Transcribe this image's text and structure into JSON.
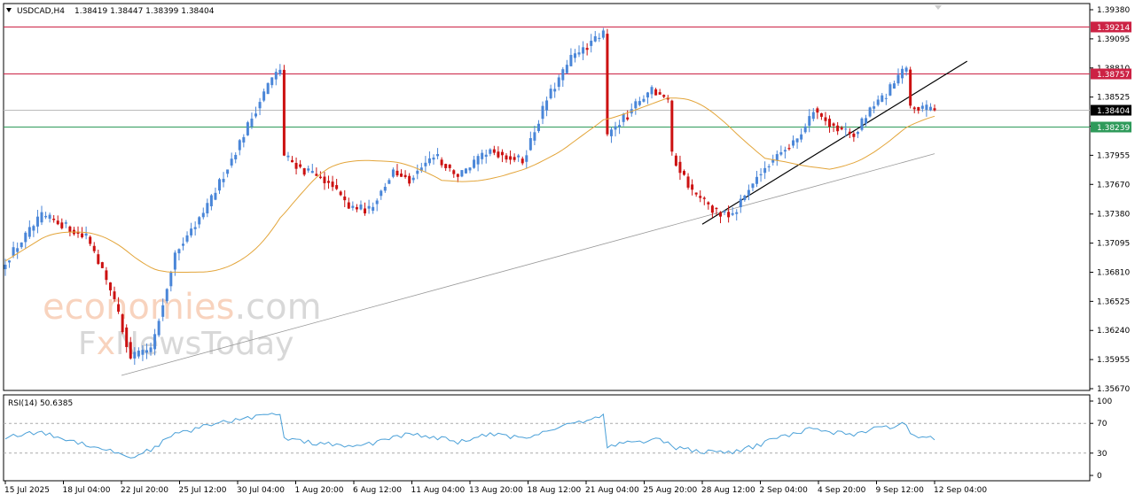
{
  "header": {
    "symbol": "USDCAD,H4",
    "ohlc": "1.38419 1.38447 1.38399 1.38404"
  },
  "watermark": {
    "line1a": "economies",
    "line1b": ".com",
    "line2a": "F",
    "line2b": "x",
    "line2c": "NewsToday"
  },
  "colors": {
    "bull": "#4a86d8",
    "bear": "#cc1111",
    "ma": "#e3a53a",
    "resistance": "#cc2244",
    "current": "#bbbbbb",
    "support": "#2e9a5a",
    "rsi": "#4aa0d8",
    "trend_main": "#000000",
    "trend_long": "#999999"
  },
  "chart_data": [
    {
      "type": "candlestick",
      "title": "",
      "x_tick_labels": [
        "15 Jul 2025",
        "18 Jul 04:00",
        "22 Jul 20:00",
        "25 Jul 12:00",
        "30 Jul 04:00",
        "1 Aug 20:00",
        "6 Aug 12:00",
        "11 Aug 04:00",
        "13 Aug 20:00",
        "18 Aug 12:00",
        "21 Aug 04:00",
        "25 Aug 20:00",
        "28 Aug 12:00",
        "2 Sep 04:00",
        "4 Sep 20:00",
        "9 Sep 12:00",
        "12 Sep 04:00"
      ],
      "y_tick_labels": [
        "1.39380",
        "1.39095",
        "1.38810",
        "1.38525",
        "1.38240",
        "1.37955",
        "1.37670",
        "1.37380",
        "1.37095",
        "1.36810",
        "1.36525",
        "1.36240",
        "1.35955",
        "1.35670"
      ],
      "ylim": [
        1.3567,
        1.3938
      ],
      "levels": [
        {
          "name": "resistance-upper",
          "value": 1.39214,
          "label": "1.39214"
        },
        {
          "name": "resistance-lower",
          "value": 1.38757,
          "label": "1.38757"
        },
        {
          "name": "current-price",
          "value": 1.38404,
          "label": "1.38404"
        },
        {
          "name": "support",
          "value": 1.38239,
          "label": "1.38239"
        }
      ],
      "anchors": [
        {
          "i": 0,
          "c": 1.3692
        },
        {
          "i": 9,
          "c": 1.3736
        },
        {
          "i": 14,
          "c": 1.3728
        },
        {
          "i": 20,
          "c": 1.3715
        },
        {
          "i": 24,
          "c": 1.3683
        },
        {
          "i": 28,
          "c": 1.364
        },
        {
          "i": 31,
          "c": 1.3598
        },
        {
          "i": 36,
          "c": 1.3605
        },
        {
          "i": 42,
          "c": 1.37
        },
        {
          "i": 50,
          "c": 1.3745
        },
        {
          "i": 57,
          "c": 1.38
        },
        {
          "i": 65,
          "c": 1.3865
        },
        {
          "i": 68,
          "c": 1.388
        },
        {
          "i": 69,
          "c": 1.3795
        },
        {
          "i": 74,
          "c": 1.378
        },
        {
          "i": 80,
          "c": 1.377
        },
        {
          "i": 85,
          "c": 1.3745
        },
        {
          "i": 90,
          "c": 1.3742
        },
        {
          "i": 96,
          "c": 1.378
        },
        {
          "i": 100,
          "c": 1.3772
        },
        {
          "i": 106,
          "c": 1.3795
        },
        {
          "i": 112,
          "c": 1.3775
        },
        {
          "i": 120,
          "c": 1.38
        },
        {
          "i": 128,
          "c": 1.379
        },
        {
          "i": 134,
          "c": 1.385
        },
        {
          "i": 140,
          "c": 1.389
        },
        {
          "i": 148,
          "c": 1.3915
        },
        {
          "i": 149,
          "c": 1.3815
        },
        {
          "i": 156,
          "c": 1.3845
        },
        {
          "i": 160,
          "c": 1.386
        },
        {
          "i": 164,
          "c": 1.385
        },
        {
          "i": 165,
          "c": 1.3795
        },
        {
          "i": 170,
          "c": 1.376
        },
        {
          "i": 176,
          "c": 1.374
        },
        {
          "i": 180,
          "c": 1.3738
        },
        {
          "i": 186,
          "c": 1.3775
        },
        {
          "i": 192,
          "c": 1.38
        },
        {
          "i": 196,
          "c": 1.381
        },
        {
          "i": 200,
          "c": 1.384
        },
        {
          "i": 205,
          "c": 1.3825
        },
        {
          "i": 210,
          "c": 1.3815
        },
        {
          "i": 214,
          "c": 1.384
        },
        {
          "i": 218,
          "c": 1.3855
        },
        {
          "i": 221,
          "c": 1.3872
        },
        {
          "i": 223,
          "c": 1.388
        },
        {
          "i": 224,
          "c": 1.3842
        },
        {
          "i": 228,
          "c": 1.3841
        },
        {
          "i": 230,
          "c": 1.38404
        }
      ],
      "trendlines": [
        {
          "name": "main-trendline",
          "points": [
            [
              "28 Aug 12:00",
              1.3728
            ],
            [
              "12 Sep 04:00",
              1.3868
            ]
          ]
        },
        {
          "name": "long-trendline",
          "points": [
            [
              "22 Jul 20:00",
              1.358
            ],
            [
              "12 Sep 04:00",
              1.3797
            ]
          ]
        }
      ],
      "moving_average": {
        "label": "",
        "type": "line"
      }
    },
    {
      "type": "line",
      "title": "RSI(14) 50.6385",
      "y_tick_labels": [
        "100",
        "70",
        "30",
        "0"
      ],
      "ylim": [
        0,
        100
      ],
      "levels": [
        70,
        30
      ],
      "rsi_anchors": [
        {
          "i": 0,
          "v": 52
        },
        {
          "i": 9,
          "v": 58
        },
        {
          "i": 14,
          "v": 50
        },
        {
          "i": 20,
          "v": 42
        },
        {
          "i": 28,
          "v": 30
        },
        {
          "i": 31,
          "v": 24
        },
        {
          "i": 36,
          "v": 35
        },
        {
          "i": 42,
          "v": 55
        },
        {
          "i": 50,
          "v": 67
        },
        {
          "i": 57,
          "v": 75
        },
        {
          "i": 65,
          "v": 82
        },
        {
          "i": 68,
          "v": 80
        },
        {
          "i": 69,
          "v": 50
        },
        {
          "i": 74,
          "v": 45
        },
        {
          "i": 80,
          "v": 42
        },
        {
          "i": 85,
          "v": 38
        },
        {
          "i": 90,
          "v": 42
        },
        {
          "i": 96,
          "v": 52
        },
        {
          "i": 100,
          "v": 55
        },
        {
          "i": 106,
          "v": 52
        },
        {
          "i": 112,
          "v": 45
        },
        {
          "i": 120,
          "v": 55
        },
        {
          "i": 128,
          "v": 50
        },
        {
          "i": 134,
          "v": 60
        },
        {
          "i": 140,
          "v": 70
        },
        {
          "i": 148,
          "v": 80
        },
        {
          "i": 149,
          "v": 40
        },
        {
          "i": 156,
          "v": 45
        },
        {
          "i": 160,
          "v": 48
        },
        {
          "i": 164,
          "v": 46
        },
        {
          "i": 165,
          "v": 38
        },
        {
          "i": 170,
          "v": 34
        },
        {
          "i": 176,
          "v": 30
        },
        {
          "i": 180,
          "v": 31
        },
        {
          "i": 186,
          "v": 40
        },
        {
          "i": 192,
          "v": 52
        },
        {
          "i": 196,
          "v": 57
        },
        {
          "i": 200,
          "v": 64
        },
        {
          "i": 205,
          "v": 58
        },
        {
          "i": 210,
          "v": 55
        },
        {
          "i": 214,
          "v": 62
        },
        {
          "i": 218,
          "v": 64
        },
        {
          "i": 221,
          "v": 68
        },
        {
          "i": 223,
          "v": 70
        },
        {
          "i": 224,
          "v": 55
        },
        {
          "i": 228,
          "v": 52
        },
        {
          "i": 230,
          "v": 50.6385
        }
      ]
    }
  ]
}
